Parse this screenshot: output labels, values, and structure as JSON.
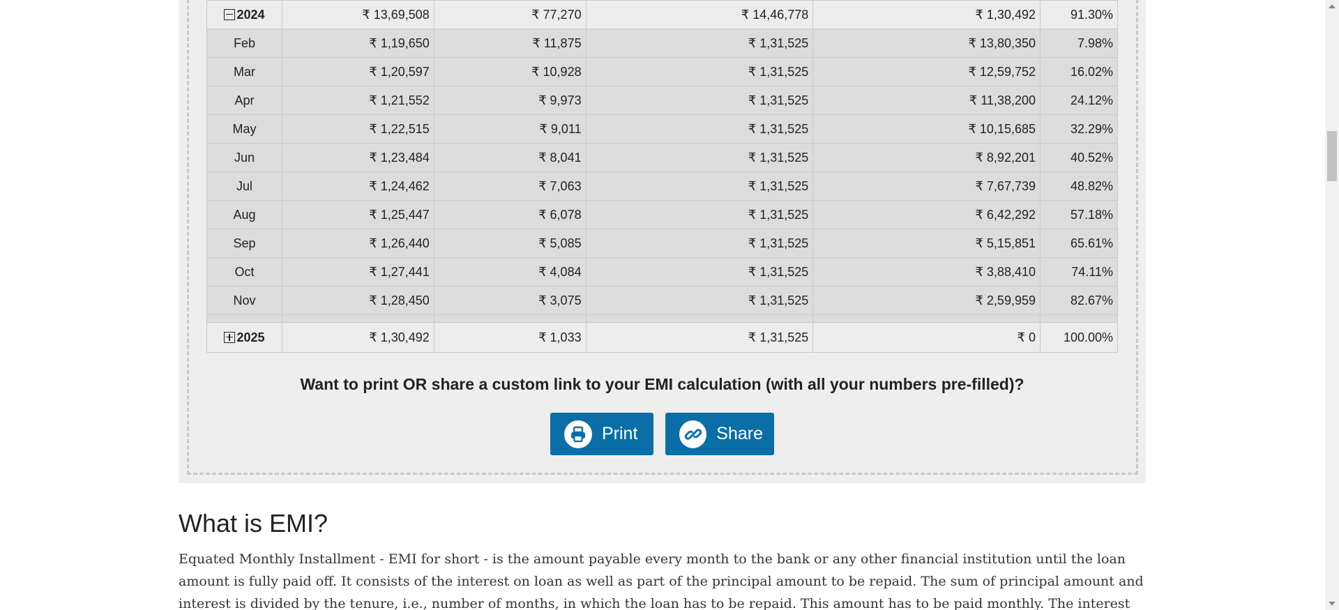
{
  "schedule": {
    "year_2024": {
      "label": "2024",
      "principal": "₹ 13,69,508",
      "interest": "₹ 77,270",
      "total_payment": "₹ 14,46,778",
      "balance": "₹ 1,30,492",
      "paid_pct": "91.30%",
      "expanded": true
    },
    "months": [
      {
        "month": "Feb",
        "principal": "₹ 1,19,650",
        "interest": "₹ 11,875",
        "total_payment": "₹ 1,31,525",
        "balance": "₹ 13,80,350",
        "paid_pct": "7.98%"
      },
      {
        "month": "Mar",
        "principal": "₹ 1,20,597",
        "interest": "₹ 10,928",
        "total_payment": "₹ 1,31,525",
        "balance": "₹ 12,59,752",
        "paid_pct": "16.02%"
      },
      {
        "month": "Apr",
        "principal": "₹ 1,21,552",
        "interest": "₹ 9,973",
        "total_payment": "₹ 1,31,525",
        "balance": "₹ 11,38,200",
        "paid_pct": "24.12%"
      },
      {
        "month": "May",
        "principal": "₹ 1,22,515",
        "interest": "₹ 9,011",
        "total_payment": "₹ 1,31,525",
        "balance": "₹ 10,15,685",
        "paid_pct": "32.29%"
      },
      {
        "month": "Jun",
        "principal": "₹ 1,23,484",
        "interest": "₹ 8,041",
        "total_payment": "₹ 1,31,525",
        "balance": "₹ 8,92,201",
        "paid_pct": "40.52%"
      },
      {
        "month": "Jul",
        "principal": "₹ 1,24,462",
        "interest": "₹ 7,063",
        "total_payment": "₹ 1,31,525",
        "balance": "₹ 7,67,739",
        "paid_pct": "48.82%"
      },
      {
        "month": "Aug",
        "principal": "₹ 1,25,447",
        "interest": "₹ 6,078",
        "total_payment": "₹ 1,31,525",
        "balance": "₹ 6,42,292",
        "paid_pct": "57.18%"
      },
      {
        "month": "Sep",
        "principal": "₹ 1,26,440",
        "interest": "₹ 5,085",
        "total_payment": "₹ 1,31,525",
        "balance": "₹ 5,15,851",
        "paid_pct": "65.61%"
      },
      {
        "month": "Oct",
        "principal": "₹ 1,27,441",
        "interest": "₹ 4,084",
        "total_payment": "₹ 1,31,525",
        "balance": "₹ 3,88,410",
        "paid_pct": "74.11%"
      },
      {
        "month": "Nov",
        "principal": "₹ 1,28,450",
        "interest": "₹ 3,075",
        "total_payment": "₹ 1,31,525",
        "balance": "₹ 2,59,959",
        "paid_pct": "82.67%"
      }
    ],
    "year_2025": {
      "label": "2025",
      "principal": "₹ 1,30,492",
      "interest": "₹ 1,033",
      "total_payment": "₹ 1,31,525",
      "balance": "₹ 0",
      "paid_pct": "100.00%",
      "expanded": false
    }
  },
  "cta": {
    "question": "Want to print OR share a custom link to your EMI calculation (with all your numbers pre-filled)?",
    "print_label": "Print",
    "share_label": "Share",
    "print_icon": "printer-icon",
    "share_icon": "link-icon",
    "button_color": "#0a6fa8"
  },
  "article": {
    "heading": "What is EMI?",
    "paragraph": "Equated Monthly Installment - EMI for short - is the amount payable every month to the bank or any other financial institution until the loan amount is fully paid off. It consists of the interest on loan as well as part of the principal amount to be repaid. The sum of principal amount and interest is divided by the tenure, i.e., number of months, in which the loan has to be repaid. This amount has to be paid monthly. The interest component of the"
  }
}
